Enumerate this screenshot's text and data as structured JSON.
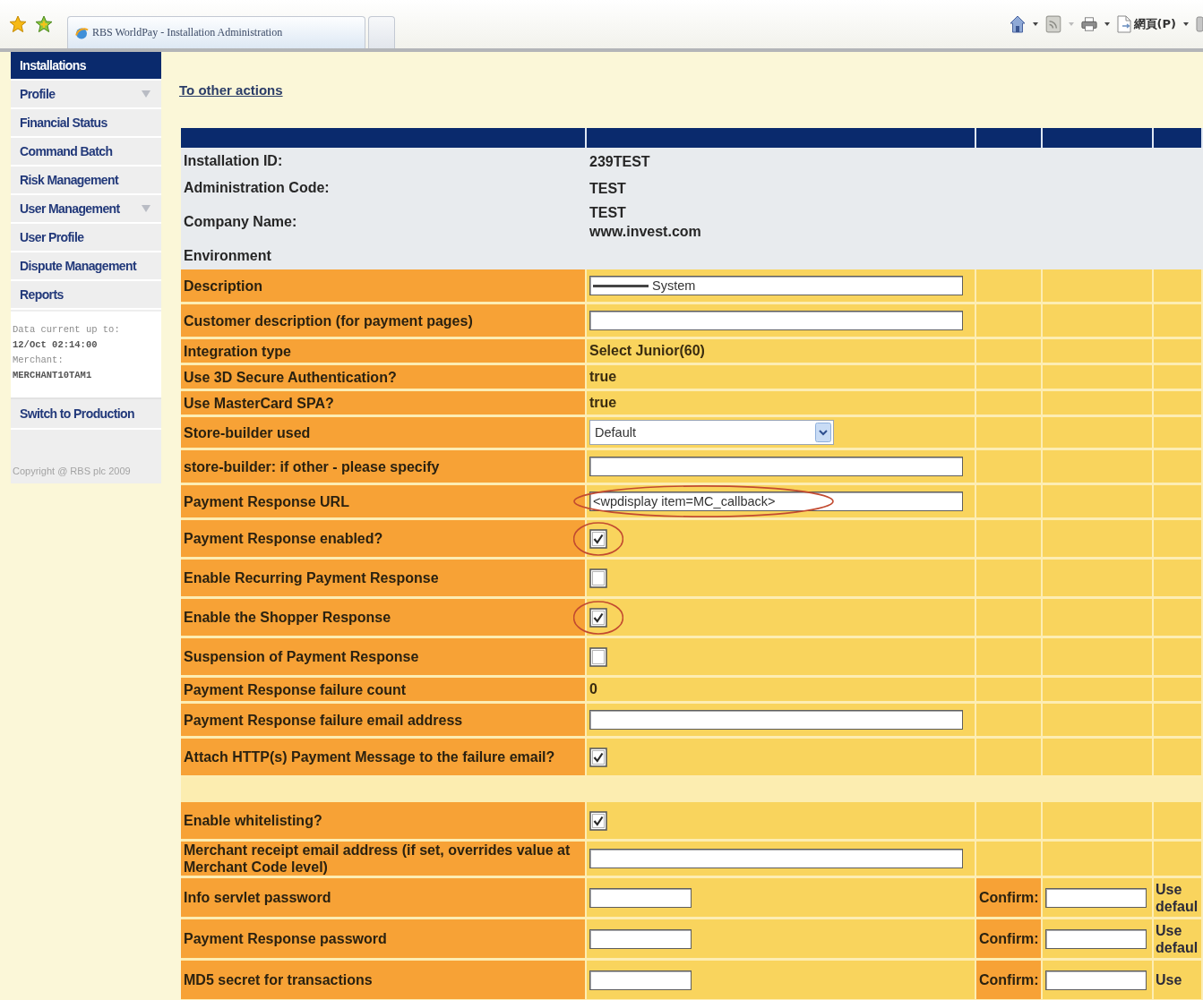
{
  "browser": {
    "tab_title": "RBS WorldPay - Installation Administration",
    "page_menu": "網頁(P)"
  },
  "sidebar": {
    "items": [
      {
        "label": "Installations",
        "selected": true,
        "expandable": false
      },
      {
        "label": "Profile",
        "selected": false,
        "expandable": true
      },
      {
        "label": "Financial Status",
        "selected": false,
        "expandable": false
      },
      {
        "label": "Command Batch",
        "selected": false,
        "expandable": false
      },
      {
        "label": "Risk Management",
        "selected": false,
        "expandable": false
      },
      {
        "label": "User Management",
        "selected": false,
        "expandable": true
      },
      {
        "label": "User Profile",
        "selected": false,
        "expandable": false
      },
      {
        "label": "Dispute Management",
        "selected": false,
        "expandable": false
      },
      {
        "label": "Reports",
        "selected": false,
        "expandable": false
      }
    ],
    "status": [
      {
        "kind": "label",
        "text": "Data current up to:"
      },
      {
        "kind": "value",
        "text": "12/Oct 02:14:00"
      },
      {
        "kind": "label",
        "text": "Merchant:"
      },
      {
        "kind": "value",
        "text": "MERCHANT10TAM1"
      }
    ],
    "switch_link": "Switch to Production",
    "copyright": "Copyright @ RBS plc 2009"
  },
  "link": "To other actions",
  "table": {
    "info_rows": [
      {
        "label": "Installation ID:",
        "values": [
          "239TEST"
        ]
      },
      {
        "label": "Administration Code:",
        "values": [
          "TEST"
        ]
      },
      {
        "label": "Company Name:",
        "values": [
          "TEST",
          "www.invest.com"
        ]
      },
      {
        "label": "Environment"
      }
    ],
    "sections": [
      {
        "rows": [
          {
            "label": "Description",
            "kind": "text",
            "value": "System",
            "redacted": true,
            "highlighted": false
          },
          {
            "label": "Customer description (for payment pages)",
            "kind": "text",
            "highlighted": false
          },
          {
            "label": "Integration type",
            "kind": "static",
            "value": "Select Junior(60)",
            "highlighted": false
          },
          {
            "label": "Use 3D Secure Authentication?",
            "kind": "static",
            "value": "true",
            "highlighted": false
          },
          {
            "label": "Use MasterCard SPA?",
            "kind": "static",
            "value": "true",
            "highlighted": false
          },
          {
            "label": "Store-builder used",
            "kind": "select",
            "value": "Default",
            "highlighted": false
          },
          {
            "label": "store-builder: if other - please specify",
            "kind": "text",
            "highlighted": false
          },
          {
            "label": "Payment Response URL",
            "kind": "text",
            "value": "<wpdisplay item=MC_callback>",
            "highlighted": true
          },
          {
            "label": "Payment Response enabled?",
            "kind": "checkbox",
            "checked": true,
            "highlighted": true
          },
          {
            "label": "Enable Recurring Payment Response",
            "kind": "checkbox",
            "checked": false,
            "highlighted": false
          },
          {
            "label": "Enable the Shopper Response",
            "kind": "checkbox",
            "checked": true,
            "highlighted": true
          },
          {
            "label": "Suspension of Payment Response",
            "kind": "checkbox",
            "checked": false,
            "highlighted": false
          },
          {
            "label": "Payment Response failure count",
            "kind": "static",
            "value": "0",
            "highlighted": false
          },
          {
            "label": "Payment Response failure email address",
            "kind": "text",
            "highlighted": false
          },
          {
            "label": "Attach HTTP(s) Payment Message to the failure email?",
            "kind": "checkbox",
            "checked": true,
            "highlighted": false
          }
        ]
      },
      {
        "rows": [
          {
            "label": "Enable whitelisting?",
            "kind": "checkbox",
            "checked": true,
            "highlighted": false
          },
          {
            "label": "Merchant receipt email address (if set, overrides value at Merchant Code level)",
            "kind": "text",
            "highlighted": false
          },
          {
            "label": "Info servlet password",
            "kind": "password",
            "confirm_label": "Confirm:",
            "note": "Use defaul",
            "highlighted": false
          },
          {
            "label": "Payment Response password",
            "kind": "password",
            "confirm_label": "Confirm:",
            "note": "Use defaul",
            "highlighted": false
          },
          {
            "label": "MD5 secret for transactions",
            "kind": "password",
            "confirm_label": "Confirm:",
            "note": "Use",
            "highlighted": false
          }
        ]
      }
    ]
  }
}
